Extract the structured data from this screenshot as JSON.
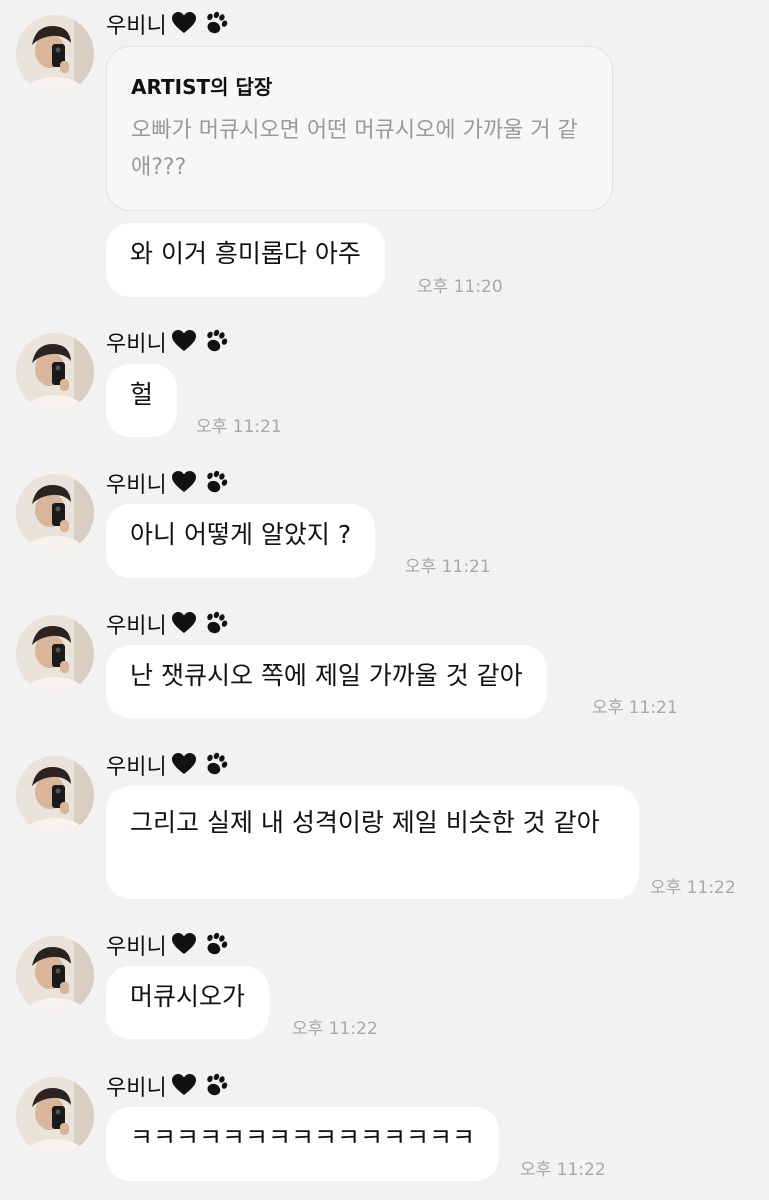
{
  "sender": {
    "name": "우비니"
  },
  "reply": {
    "title": "ARTIST의 답장",
    "text": "오빠가 머큐시오면 어떤 머큐시오에 가까울 거 같애???"
  },
  "messages": [
    {
      "text": "와 이거 흥미롭다 아주",
      "time": "오후 11:20"
    },
    {
      "text": "헐",
      "time": "오후 11:21"
    },
    {
      "text": "아니 어떻게 알았지 ?",
      "time": "오후 11:21"
    },
    {
      "text": "난 잿큐시오 쪽에 제일 가까울 것 같아",
      "time": "오후 11:21"
    },
    {
      "text": "그리고 실제 내 성격이랑 제일 비슷한 것 같아",
      "time": "오후 11:22"
    },
    {
      "text": "머큐시오가",
      "time": "오후 11:22"
    },
    {
      "text": "ㅋㅋㅋㅋㅋㅋㅋㅋㅋㅋㅋㅋㅋㅋㅋ",
      "time": "오후 11:22"
    }
  ]
}
